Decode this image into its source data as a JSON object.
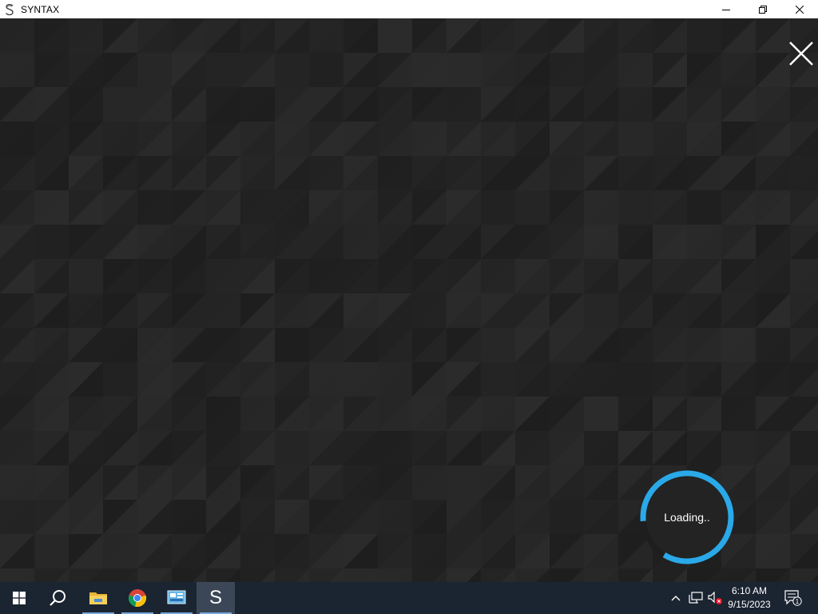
{
  "window": {
    "title": "SYNTAX",
    "app_icon": "syntax-s-icon",
    "controls": {
      "minimize": "minimize-icon",
      "restore": "restore-icon",
      "close": "close-icon"
    }
  },
  "content": {
    "close_icon": "close-icon",
    "loading_text": "Loading..",
    "spinner_progress": 0.85,
    "colors": {
      "background": "#262626",
      "spinner_accent": "#2aa9e9",
      "spinner_track": "#1e1e1e"
    }
  },
  "taskbar": {
    "items": [
      {
        "name": "start",
        "icon": "windows-logo-icon"
      },
      {
        "name": "search",
        "icon": "search-icon"
      },
      {
        "name": "file-explorer",
        "icon": "folder-icon",
        "running": true
      },
      {
        "name": "chrome",
        "icon": "chrome-icon",
        "running": true
      },
      {
        "name": "control-panel",
        "icon": "control-panel-icon",
        "running": true
      },
      {
        "name": "syntax",
        "icon": "syntax-s-icon",
        "running": true,
        "active": true
      }
    ],
    "tray": {
      "overflow_icon": "chevron-up-icon",
      "network_icon": "network-icon",
      "volume_icon": "volume-muted-icon",
      "notification_icon": "notification-icon",
      "notification_count": "1"
    },
    "clock": {
      "time": "6:10 AM",
      "date": "9/15/2023"
    }
  }
}
